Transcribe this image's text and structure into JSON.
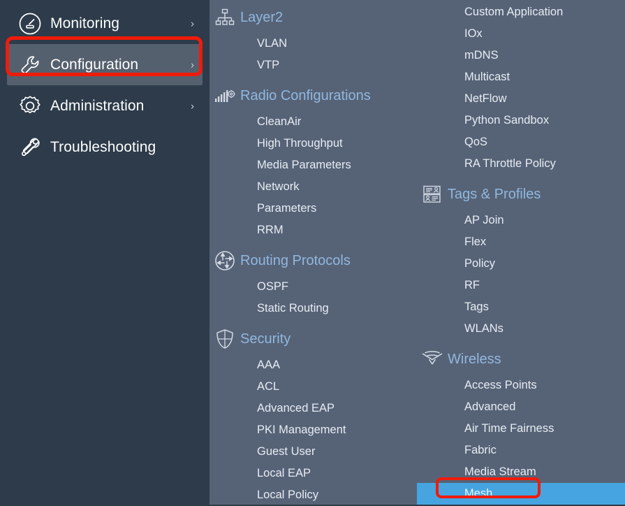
{
  "colors": {
    "left_nav_bg": "#2d3b4a",
    "submenu_bg": "#566377",
    "selected_nav_bg": "#55606e",
    "group_title": "#92b7dd",
    "leaf_text": "#e7ecf2",
    "active_leaf_bg": "#46a5e0",
    "annotation_red": "#f01b0a"
  },
  "left_nav": {
    "items": [
      {
        "label": "Monitoring",
        "icon": "gauge-icon",
        "chevron": "›",
        "has_chevron": true,
        "selected": false
      },
      {
        "label": "Configuration",
        "icon": "wrench-icon",
        "chevron": "›",
        "has_chevron": true,
        "selected": true
      },
      {
        "label": "Administration",
        "icon": "gear-icon",
        "chevron": "›",
        "has_chevron": true,
        "selected": false
      },
      {
        "label": "Troubleshooting",
        "icon": "screwdriver-wrench-icon",
        "chevron": "",
        "has_chevron": false,
        "selected": false
      }
    ]
  },
  "submenu": {
    "left_column": [
      {
        "title": "Layer2",
        "icon": "hierarchy-icon",
        "items": [
          "VLAN",
          "VTP"
        ]
      },
      {
        "title": "Radio Configurations",
        "icon": "signal-gear-icon",
        "items": [
          "CleanAir",
          "High Throughput",
          "Media Parameters",
          "Network",
          "Parameters",
          "RRM"
        ]
      },
      {
        "title": "Routing Protocols",
        "icon": "router-arrows-icon",
        "items": [
          "OSPF",
          "Static Routing"
        ]
      },
      {
        "title": "Security",
        "icon": "shield-icon",
        "items": [
          "AAA",
          "ACL",
          "Advanced EAP",
          "PKI Management",
          "Guest User",
          "Local EAP",
          "Local Policy"
        ]
      }
    ],
    "right_column": [
      {
        "title": "",
        "icon": "",
        "items": [
          "Custom Application",
          "IOx",
          "mDNS",
          "Multicast",
          "NetFlow",
          "Python Sandbox",
          "QoS",
          "RA Throttle Policy"
        ]
      },
      {
        "title": "Tags & Profiles",
        "icon": "id-cards-icon",
        "items": [
          "AP Join",
          "Flex",
          "Policy",
          "RF",
          "Tags",
          "WLANs"
        ]
      },
      {
        "title": "Wireless",
        "icon": "wifi-icon",
        "items": [
          "Access Points",
          "Advanced",
          "Air Time Fairness",
          "Fabric",
          "Media Stream",
          "Mesh"
        ]
      }
    ],
    "active_item": "Mesh"
  },
  "annotations": [
    {
      "name": "configuration-highlight",
      "target": "Configuration"
    },
    {
      "name": "mesh-highlight",
      "target": "Mesh"
    }
  ]
}
